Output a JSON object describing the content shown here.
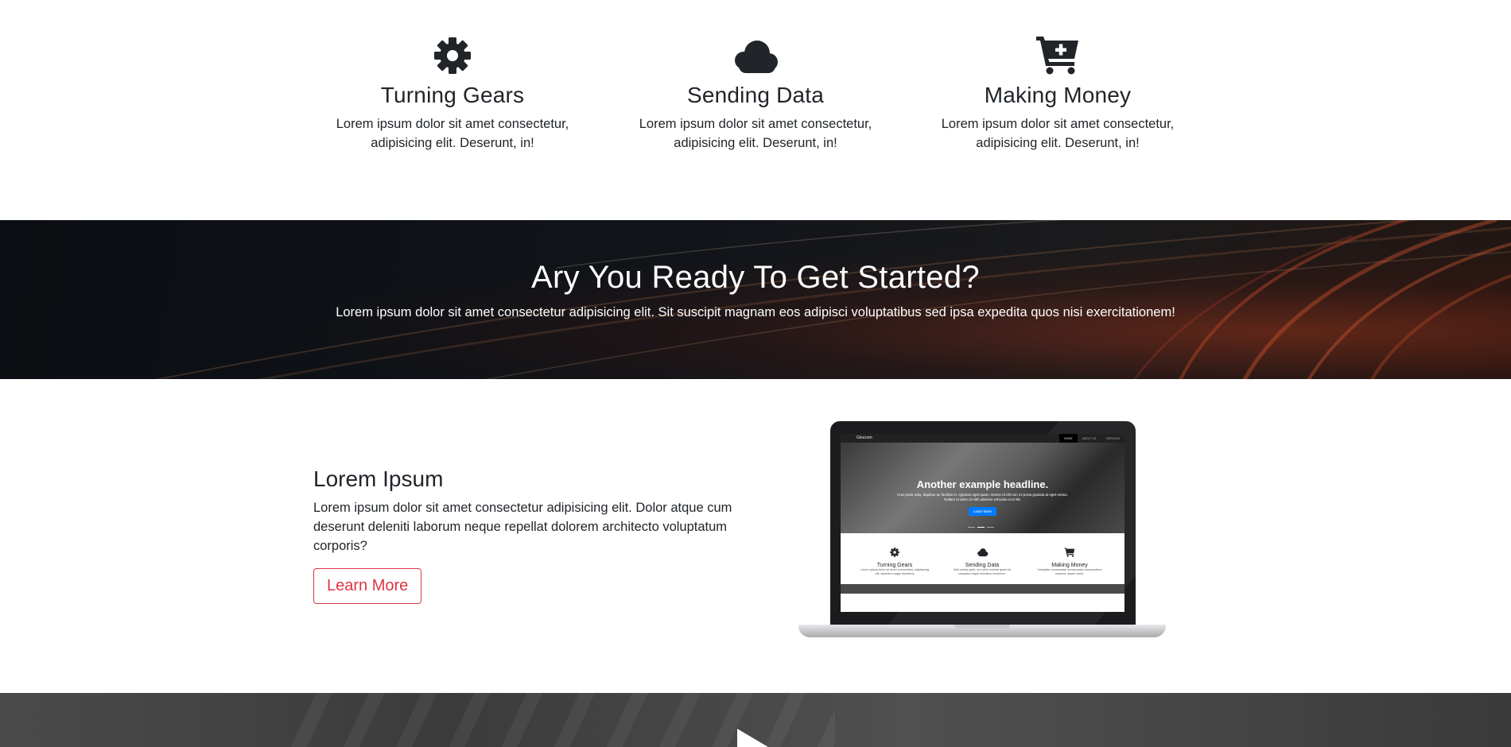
{
  "features": [
    {
      "icon": "gear-icon",
      "title": "Turning Gears",
      "text": "Lorem ipsum dolor sit amet consectetur, adipisicing elit. Deserunt, in!"
    },
    {
      "icon": "cloud-icon",
      "title": "Sending Data",
      "text": "Lorem ipsum dolor sit amet consectetur, adipisicing elit. Deserunt, in!"
    },
    {
      "icon": "cart-plus-icon",
      "title": "Making Money",
      "text": "Lorem ipsum dolor sit amet consectetur, adipisicing elit. Deserunt, in!"
    }
  ],
  "banner": {
    "title": "Ary You Ready To Get Started?",
    "text": "Lorem ipsum dolor sit amet consectetur adipisicing elit. Sit suscipit magnam eos adipisci voluptatibus sed ipsa expedita quos nisi exercitationem!"
  },
  "info": {
    "title": "Lorem Ipsum",
    "text": "Lorem ipsum dolor sit amet consectetur adipisicing elit. Dolor atque cum deserunt deleniti laborum neque repellat dolorem architecto voluptatum corporis?",
    "button": "Learn More"
  },
  "laptop_screen": {
    "brand": "Glozzom",
    "nav": [
      "HOME",
      "ABOUT US",
      "SERVICES"
    ],
    "hero_title": "Another example headline.",
    "hero_text": "Cras justo odio, dapibus ac facilisis in, egestas eget quam. Donec id elit non mi porta gravida at eget metus. Nullam id dolor id nibh ultricies vehicula ut id elit.",
    "hero_button": "Learn More",
    "features": [
      {
        "title": "Turning Gears",
        "text": "Lorem ipsum dolor sit amet consectetur, adipisicing elit. Aperiam magni doloribus"
      },
      {
        "title": "Sending Data",
        "text": "Velit soluta optio, ad nobis eveniet quae hic voluptas magni doloribus inventore."
      },
      {
        "title": "Making Money",
        "text": "Voluptate recusandae consequatur accusantium maiores, ipsam dolor."
      }
    ]
  },
  "colors": {
    "accent": "#dc3545",
    "dark": "#212529",
    "screen_button": "#007bff"
  }
}
